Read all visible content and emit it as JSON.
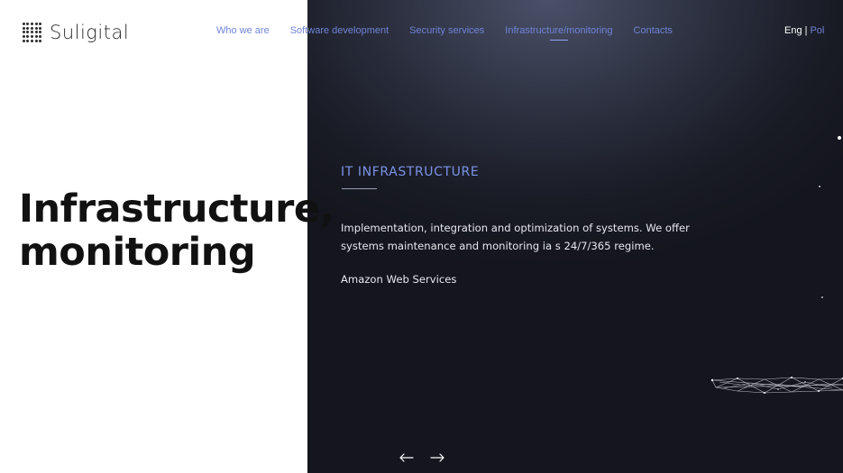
{
  "brand": {
    "name": "Suligital"
  },
  "nav": {
    "items": [
      {
        "label": "Who we are",
        "active": false
      },
      {
        "label": "Software development",
        "active": false
      },
      {
        "label": "Security services",
        "active": false
      },
      {
        "label": "Infrastructure/monitoring",
        "active": true
      },
      {
        "label": "Contacts",
        "active": false
      }
    ]
  },
  "lang": {
    "current": "Eng",
    "separator": "|",
    "other": "Pol"
  },
  "hero": {
    "line1": "Infrastructure,",
    "line2": "monitoring"
  },
  "section": {
    "title": "IT INFRASTRUCTURE",
    "description": "Implementation, integration and optimization of systems. We offer systems maintenance and monitoring ia s 24/7/365 regime.",
    "extra": "Amazon Web Services"
  },
  "icons": {
    "prev": "arrow-left-icon",
    "next": "arrow-right-icon",
    "logo": "dot-grid-logo-icon"
  },
  "colors": {
    "accent": "#6f84d8",
    "dark_panel": "#191b25",
    "heading": "#111111"
  }
}
